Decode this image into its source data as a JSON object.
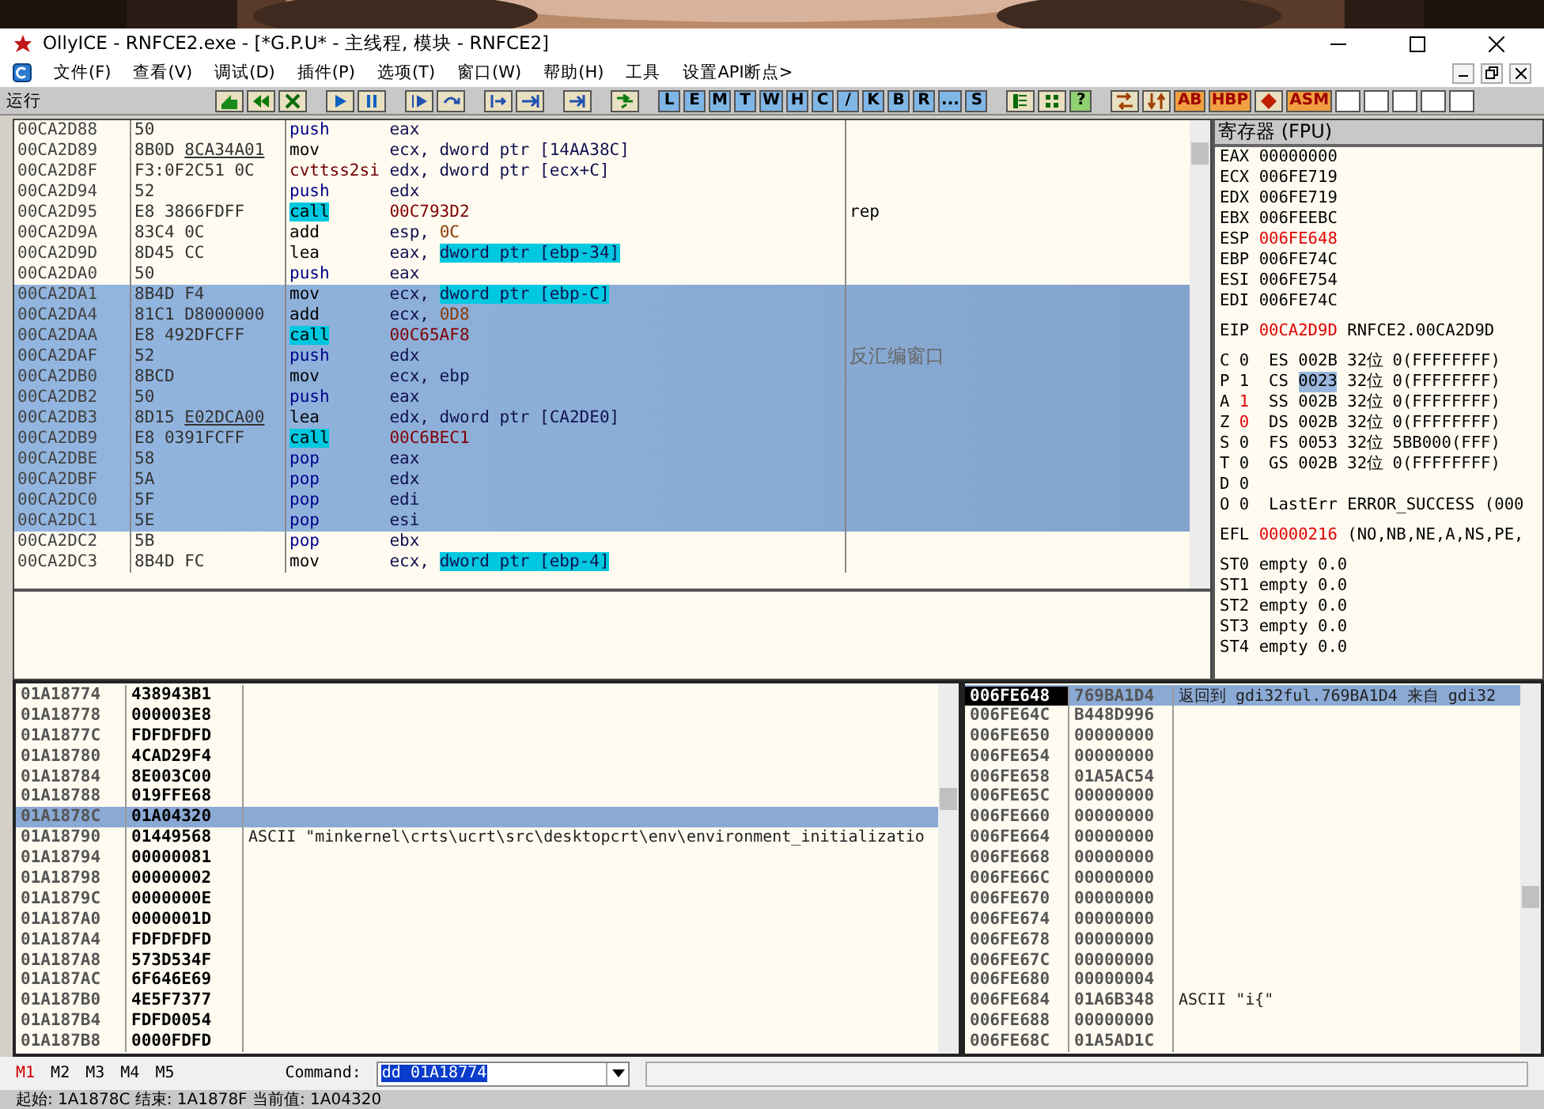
{
  "window": {
    "title": "OllyICE - RNFCE2.exe - [*G.P.U* - 主线程, 模块 - RNFCE2]"
  },
  "menu": [
    "文件(F)",
    "查看(V)",
    "调试(D)",
    "插件(P)",
    "选项(T)",
    "窗口(W)",
    "帮助(H)",
    "工具",
    "设置API断点>"
  ],
  "toolbar": {
    "status": "运行",
    "items": [
      {
        "kind": "icon"
      },
      {
        "kind": "icon"
      },
      {
        "kind": "icon"
      },
      {
        "kind": "gap"
      },
      {
        "kind": "icon"
      },
      {
        "kind": "icon"
      },
      {
        "kind": "gap"
      },
      {
        "kind": "icon"
      },
      {
        "kind": "icon"
      },
      {
        "kind": "gap"
      },
      {
        "kind": "icon"
      },
      {
        "kind": "icon"
      },
      {
        "kind": "gap"
      },
      {
        "kind": "icon"
      },
      {
        "kind": "gap"
      },
      {
        "kind": "icon"
      },
      {
        "kind": "gap"
      },
      {
        "kind": "letter",
        "label": "L"
      },
      {
        "kind": "letter",
        "label": "E"
      },
      {
        "kind": "letter",
        "label": "M"
      },
      {
        "kind": "letter",
        "label": "T"
      },
      {
        "kind": "letter",
        "label": "W"
      },
      {
        "kind": "letter",
        "label": "H"
      },
      {
        "kind": "letter",
        "label": "C"
      },
      {
        "kind": "letter",
        "label": "/"
      },
      {
        "kind": "letter",
        "label": "K"
      },
      {
        "kind": "letter",
        "label": "B"
      },
      {
        "kind": "letter",
        "label": "R"
      },
      {
        "kind": "letter",
        "label": "..."
      },
      {
        "kind": "letter",
        "label": "S"
      },
      {
        "kind": "gap"
      },
      {
        "kind": "icon"
      },
      {
        "kind": "icon"
      },
      {
        "kind": "help",
        "label": "?"
      },
      {
        "kind": "gap"
      },
      {
        "kind": "icon"
      },
      {
        "kind": "icon"
      },
      {
        "kind": "tag",
        "label": "AB"
      },
      {
        "kind": "tag",
        "label": "HBP"
      },
      {
        "kind": "icon"
      },
      {
        "kind": "tag",
        "label": "ASM"
      },
      {
        "kind": "blank"
      },
      {
        "kind": "blank"
      },
      {
        "kind": "blank"
      },
      {
        "kind": "blank"
      },
      {
        "kind": "blank"
      }
    ]
  },
  "disasm": {
    "rows": [
      {
        "address": "00CA2D88",
        "hex": "50",
        "mnemonic": {
          "text": "push",
          "kind": "stack"
        },
        "operands": [
          {
            "text": "eax",
            "kind": "plain"
          }
        ],
        "selected": false
      },
      {
        "address": "00CA2D89",
        "hex": "8B0D",
        "fixup": "8CA34A01",
        "mnemonic": {
          "text": "mov",
          "kind": "normal"
        },
        "operands": [
          {
            "text": "ecx, dword ptr [14AA38C]",
            "kind": "plain"
          }
        ],
        "selected": false
      },
      {
        "address": "00CA2D8F",
        "hex": "F3:0F2C51 0C",
        "mnemonic": {
          "text": "cvttss2si",
          "kind": "sse"
        },
        "operands": [
          {
            "text": "edx, dword ptr [ecx+C]",
            "kind": "plain"
          }
        ],
        "selected": false
      },
      {
        "address": "00CA2D94",
        "hex": "52",
        "mnemonic": {
          "text": "push",
          "kind": "stack"
        },
        "operands": [
          {
            "text": "edx",
            "kind": "plain"
          }
        ],
        "selected": false
      },
      {
        "address": "00CA2D95",
        "hex": "E8 3866FDFF",
        "mnemonic": {
          "text": "call",
          "kind": "call"
        },
        "operands": [
          {
            "text": "00C793D2",
            "kind": "addr"
          }
        ],
        "comment": {
          "text": "rep",
          "kind": "plain"
        },
        "selected": false
      },
      {
        "address": "00CA2D9A",
        "hex": "83C4 0C",
        "mnemonic": {
          "text": "add",
          "kind": "normal"
        },
        "operands": [
          {
            "text": "esp, ",
            "kind": "plain"
          },
          {
            "text": "0C",
            "kind": "const"
          }
        ],
        "selected": false
      },
      {
        "address": "00CA2D9D",
        "hex": "8D45 CC",
        "mnemonic": {
          "text": "lea",
          "kind": "normal"
        },
        "operands": [
          {
            "text": "eax, ",
            "kind": "plain"
          },
          {
            "text": "dword ptr [ebp-34]",
            "kind": "mem"
          }
        ],
        "selected": false
      },
      {
        "address": "00CA2DA0",
        "hex": "50",
        "mnemonic": {
          "text": "push",
          "kind": "stack"
        },
        "operands": [
          {
            "text": "eax",
            "kind": "plain"
          }
        ],
        "selected": false
      },
      {
        "address": "00CA2DA1",
        "hex": "8B4D F4",
        "mnemonic": {
          "text": "mov",
          "kind": "normal"
        },
        "operands": [
          {
            "text": "ecx, ",
            "kind": "plain"
          },
          {
            "text": "dword ptr [ebp-C]",
            "kind": "mem"
          }
        ],
        "selected": true
      },
      {
        "address": "00CA2DA4",
        "hex": "81C1 D8000000",
        "mnemonic": {
          "text": "add",
          "kind": "normal"
        },
        "operands": [
          {
            "text": "ecx, ",
            "kind": "plain"
          },
          {
            "text": "0D8",
            "kind": "const"
          }
        ],
        "selected": true
      },
      {
        "address": "00CA2DAA",
        "hex": "E8 492DFCFF",
        "mnemonic": {
          "text": "call",
          "kind": "call"
        },
        "operands": [
          {
            "text": "00C65AF8",
            "kind": "addr"
          }
        ],
        "selected": true
      },
      {
        "address": "00CA2DAF",
        "hex": "52",
        "mnemonic": {
          "text": "push",
          "kind": "stack"
        },
        "operands": [
          {
            "text": "edx",
            "kind": "plain"
          }
        ],
        "comment": {
          "text": "反汇编窗口",
          "kind": "annotation"
        },
        "selected": true
      },
      {
        "address": "00CA2DB0",
        "hex": "8BCD",
        "mnemonic": {
          "text": "mov",
          "kind": "normal"
        },
        "operands": [
          {
            "text": "ecx, ebp",
            "kind": "plain"
          }
        ],
        "selected": true
      },
      {
        "address": "00CA2DB2",
        "hex": "50",
        "mnemonic": {
          "text": "push",
          "kind": "stack"
        },
        "operands": [
          {
            "text": "eax",
            "kind": "plain"
          }
        ],
        "selected": true
      },
      {
        "address": "00CA2DB3",
        "hex": "8D15",
        "fixup": "E02DCA00",
        "mnemonic": {
          "text": "lea",
          "kind": "normal"
        },
        "operands": [
          {
            "text": "edx, dword ptr [CA2DE0]",
            "kind": "plain"
          }
        ],
        "selected": true
      },
      {
        "address": "00CA2DB9",
        "hex": "E8 0391FCFF",
        "mnemonic": {
          "text": "call",
          "kind": "call"
        },
        "operands": [
          {
            "text": "00C6BEC1",
            "kind": "addr"
          }
        ],
        "selected": true
      },
      {
        "address": "00CA2DBE",
        "hex": "58",
        "mnemonic": {
          "text": "pop",
          "kind": "stack"
        },
        "operands": [
          {
            "text": "eax",
            "kind": "plain"
          }
        ],
        "selected": true
      },
      {
        "address": "00CA2DBF",
        "hex": "5A",
        "mnemonic": {
          "text": "pop",
          "kind": "stack"
        },
        "operands": [
          {
            "text": "edx",
            "kind": "plain"
          }
        ],
        "selected": true
      },
      {
        "address": "00CA2DC0",
        "hex": "5F",
        "mnemonic": {
          "text": "pop",
          "kind": "stack"
        },
        "operands": [
          {
            "text": "edi",
            "kind": "plain"
          }
        ],
        "selected": true
      },
      {
        "address": "00CA2DC1",
        "hex": "5E",
        "mnemonic": {
          "text": "pop",
          "kind": "stack"
        },
        "operands": [
          {
            "text": "esi",
            "kind": "plain"
          }
        ],
        "selected": true
      },
      {
        "address": "00CA2DC2",
        "hex": "5B",
        "mnemonic": {
          "text": "pop",
          "kind": "stack"
        },
        "operands": [
          {
            "text": "ebx",
            "kind": "plain"
          }
        ],
        "selected": false
      },
      {
        "address": "00CA2DC3",
        "hex": "8B4D FC",
        "mnemonic": {
          "text": "mov",
          "kind": "normal"
        },
        "operands": [
          {
            "text": "ecx, ",
            "kind": "plain"
          },
          {
            "text": "dword ptr [ebp-4]",
            "kind": "mem"
          }
        ],
        "selected": false
      }
    ]
  },
  "registers": {
    "title": "寄存器 (FPU)",
    "general": [
      {
        "name": "EAX",
        "value": "00000000",
        "changed": false
      },
      {
        "name": "ECX",
        "value": "006FE719",
        "changed": false
      },
      {
        "name": "EDX",
        "value": "006FE719",
        "changed": false
      },
      {
        "name": "EBX",
        "value": "006FEEBC",
        "changed": false
      },
      {
        "name": "ESP",
        "value": "006FE648",
        "changed": true
      },
      {
        "name": "EBP",
        "value": "006FE74C",
        "changed": false
      },
      {
        "name": "ESI",
        "value": "006FE754",
        "changed": false
      },
      {
        "name": "EDI",
        "value": "006FE74C",
        "changed": false
      }
    ],
    "eip": {
      "name": "EIP",
      "value": "00CA2D9D",
      "changed": true,
      "symbol": "RNFCE2.00CA2D9D"
    },
    "flags": [
      {
        "name": "C",
        "value": "0",
        "changed": false
      },
      {
        "name": "P",
        "value": "1",
        "changed": false
      },
      {
        "name": "A",
        "value": "1",
        "changed": true
      },
      {
        "name": "Z",
        "value": "0",
        "changed": true
      },
      {
        "name": "S",
        "value": "0",
        "changed": false
      },
      {
        "name": "T",
        "value": "0",
        "changed": false
      },
      {
        "name": "D",
        "value": "0",
        "changed": false
      },
      {
        "name": "O",
        "value": "0",
        "changed": false
      }
    ],
    "segments": [
      {
        "name": "ES",
        "selector": "002B",
        "bits": "32位",
        "base": "0(FFFFFFFF)",
        "selected": false
      },
      {
        "name": "CS",
        "selector": "0023",
        "bits": "32位",
        "base": "0(FFFFFFFF)",
        "selected": true
      },
      {
        "name": "SS",
        "selector": "002B",
        "bits": "32位",
        "base": "0(FFFFFFFF)",
        "selected": false
      },
      {
        "name": "DS",
        "selector": "002B",
        "bits": "32位",
        "base": "0(FFFFFFFF)",
        "selected": false
      },
      {
        "name": "FS",
        "selector": "0053",
        "bits": "32位",
        "base": "5BB000(FFF)",
        "selected": false
      },
      {
        "name": "GS",
        "selector": "002B",
        "bits": "32位",
        "base": "0(FFFFFFFF)",
        "selected": false
      }
    ],
    "last_error": {
      "label": "LastErr",
      "value": "ERROR_SUCCESS (000"
    },
    "efl": {
      "name": "EFL",
      "value": "00000216",
      "changed": true,
      "text": "(NO,NB,NE,A,NS,PE,"
    },
    "fpu": [
      {
        "name": "ST0",
        "tag": "empty",
        "value": "0.0"
      },
      {
        "name": "ST1",
        "tag": "empty",
        "value": "0.0"
      },
      {
        "name": "ST2",
        "tag": "empty",
        "value": "0.0"
      },
      {
        "name": "ST3",
        "tag": "empty",
        "value": "0.0"
      },
      {
        "name": "ST4",
        "tag": "empty",
        "value": "0.0"
      }
    ]
  },
  "dump": {
    "rows": [
      {
        "address": "01A18774",
        "value": "438943B1",
        "selected": false
      },
      {
        "address": "01A18778",
        "value": "000003E8",
        "selected": false
      },
      {
        "address": "01A1877C",
        "value": "FDFDFDFD",
        "selected": false
      },
      {
        "address": "01A18780",
        "value": "4CAD29F4",
        "selected": false
      },
      {
        "address": "01A18784",
        "value": "8E003C00",
        "selected": false
      },
      {
        "address": "01A18788",
        "value": "019FFE68",
        "selected": false
      },
      {
        "address": "01A1878C",
        "value": "01A04320",
        "selected": true
      },
      {
        "address": "01A18790",
        "value": "01449568",
        "comment": "ASCII \"minkernel\\crts\\ucrt\\src\\desktopcrt\\env\\environment_initializatio",
        "selected": false
      },
      {
        "address": "01A18794",
        "value": "00000081",
        "selected": false
      },
      {
        "address": "01A18798",
        "value": "00000002",
        "selected": false
      },
      {
        "address": "01A1879C",
        "value": "0000000E",
        "selected": false
      },
      {
        "address": "01A187A0",
        "value": "0000001D",
        "selected": false
      },
      {
        "address": "01A187A4",
        "value": "FDFDFDFD",
        "selected": false
      },
      {
        "address": "01A187A8",
        "value": "573D534F",
        "selected": false
      },
      {
        "address": "01A187AC",
        "value": "6F646E69",
        "selected": false
      },
      {
        "address": "01A187B0",
        "value": "4E5F7377",
        "selected": false
      },
      {
        "address": "01A187B4",
        "value": "FDFD0054",
        "selected": false
      },
      {
        "address": "01A187B8",
        "value": "0000FDFD",
        "selected": false
      }
    ]
  },
  "stack": {
    "rows": [
      {
        "address": "006FE648",
        "value": "769BA1D4",
        "comment": "返回到 gdi32ful.769BA1D4 来自 gdi32",
        "selected": true
      },
      {
        "address": "006FE64C",
        "value": "B448D996",
        "selected": false
      },
      {
        "address": "006FE650",
        "value": "00000000",
        "selected": false
      },
      {
        "address": "006FE654",
        "value": "00000000",
        "selected": false
      },
      {
        "address": "006FE658",
        "value": "01A5AC54",
        "selected": false
      },
      {
        "address": "006FE65C",
        "value": "00000000",
        "selected": false
      },
      {
        "address": "006FE660",
        "value": "00000000",
        "selected": false
      },
      {
        "address": "006FE664",
        "value": "00000000",
        "selected": false
      },
      {
        "address": "006FE668",
        "value": "00000000",
        "selected": false
      },
      {
        "address": "006FE66C",
        "value": "00000000",
        "selected": false
      },
      {
        "address": "006FE670",
        "value": "00000000",
        "selected": false
      },
      {
        "address": "006FE674",
        "value": "00000000",
        "selected": false
      },
      {
        "address": "006FE678",
        "value": "00000000",
        "selected": false
      },
      {
        "address": "006FE67C",
        "value": "00000000",
        "selected": false
      },
      {
        "address": "006FE680",
        "value": "00000004",
        "selected": false
      },
      {
        "address": "006FE684",
        "value": "01A6B348",
        "comment": "ASCII \"i{\"",
        "selected": false
      },
      {
        "address": "006FE688",
        "value": "00000000",
        "selected": false
      },
      {
        "address": "006FE68C",
        "value": "01A5AD1C",
        "selected": false
      }
    ]
  },
  "command_bar": {
    "tabs": [
      {
        "label": "M1",
        "selected": true
      },
      {
        "label": "M2",
        "selected": false
      },
      {
        "label": "M3",
        "selected": false
      },
      {
        "label": "M4",
        "selected": false
      },
      {
        "label": "M5",
        "selected": false
      }
    ],
    "label": "Command:",
    "value": "dd 01A18774"
  },
  "status_bar": {
    "text": "起始: 1A1878C 结束: 1A1878F 当前值: 1A04320"
  }
}
